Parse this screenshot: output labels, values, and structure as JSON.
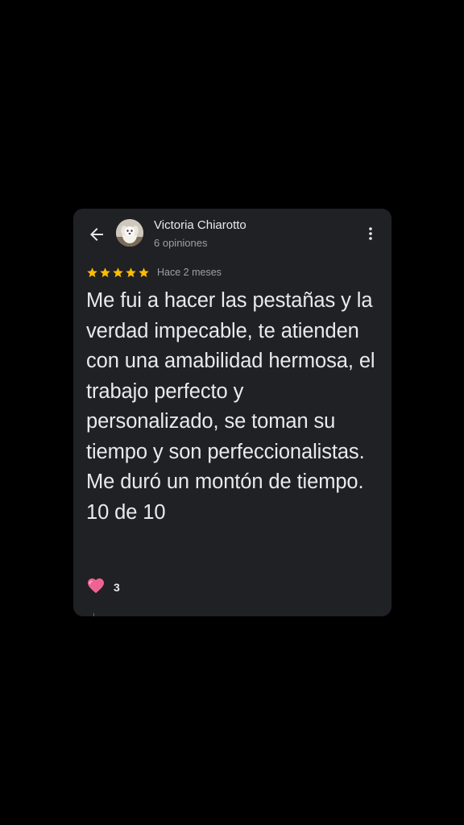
{
  "reviewer": {
    "name": "Victoria Chiarotto",
    "reviews_count": "6 opiniones",
    "avatar_icon": "dog-photo"
  },
  "review": {
    "rating": 5,
    "rating_max": 5,
    "star_color": "#fbbc04",
    "time_ago": "Hace 2 meses",
    "text": "Me fui a hacer las pestañas y la verdad impecable, te atienden con una amabilidad hermosa, el trabajo perfecto y personalizado, se toman su tiempo y son perfeccionalistas. Me duró un montón de tiempo. 10 de 10"
  },
  "reactions": {
    "icon": "heart-icon",
    "heart_color": "#f06292",
    "count": "3"
  },
  "nav": {
    "back_icon": "arrow-left-icon",
    "menu_icon": "more-vert-icon"
  },
  "theme": {
    "background": "#000000",
    "card": "#202124",
    "text_primary": "#e8eaed",
    "text_secondary": "#9aa0a6"
  }
}
